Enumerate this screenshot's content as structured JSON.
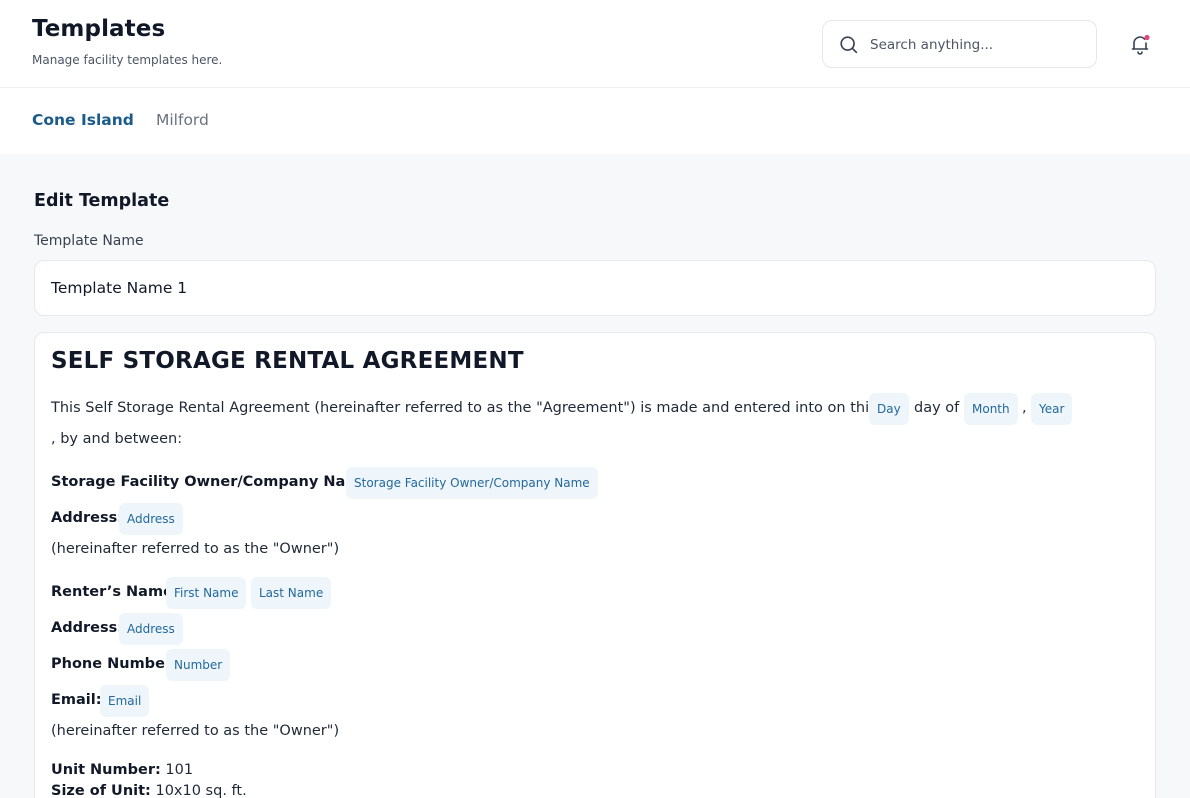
{
  "header": {
    "title": "Templates",
    "subtitle": "Manage facility templates here.",
    "search_placeholder": "Search anything..."
  },
  "tabs": [
    {
      "label": "Cone Island",
      "active": true
    },
    {
      "label": "Milford",
      "active": false
    }
  ],
  "editor": {
    "section_title": "Edit Template",
    "name_label": "Template Name",
    "name_value": "Template Name 1"
  },
  "document": {
    "title": "SELF STORAGE RENTAL AGREEMENT",
    "intro": "This Self Storage Rental Agreement (hereinafter referred to as the \"Agreement\") is made and entered into on this",
    "day_tag": "Day",
    "day_of": "day of",
    "month_tag": "Month",
    "comma": ",",
    "year_tag": "Year",
    "by_between": ", by and between:",
    "owner_label": "Storage Facility Owner/Company Name:",
    "owner_tag": "Storage Facility Owner/Company Name",
    "owner_address_label": "Address:",
    "owner_address_tag": "Address",
    "owner_ref": "(hereinafter referred to as the \"Owner\")",
    "renter_label": "Renter’s Name:",
    "first_name_tag": "First Name",
    "last_name_tag": "Last Name",
    "renter_address_label": "Address:",
    "renter_address_tag": "Address",
    "phone_label": "Phone Number:",
    "phone_tag": "Number",
    "email_label": "Email:",
    "email_tag": "Email",
    "renter_ref": "(hereinafter referred to as the \"Owner\")",
    "unit_label": "Unit Number:",
    "unit_value": "101",
    "size_label": "Size of Unit:",
    "size_value": "10x10 sq. ft."
  },
  "colors": {
    "accent": "#1b5b8a",
    "tag_bg": "#eef6fc",
    "tag_text": "#23689a",
    "notification_dot": "#e0457b"
  },
  "icons": {
    "search": "search-icon",
    "bell": "bell-icon"
  }
}
